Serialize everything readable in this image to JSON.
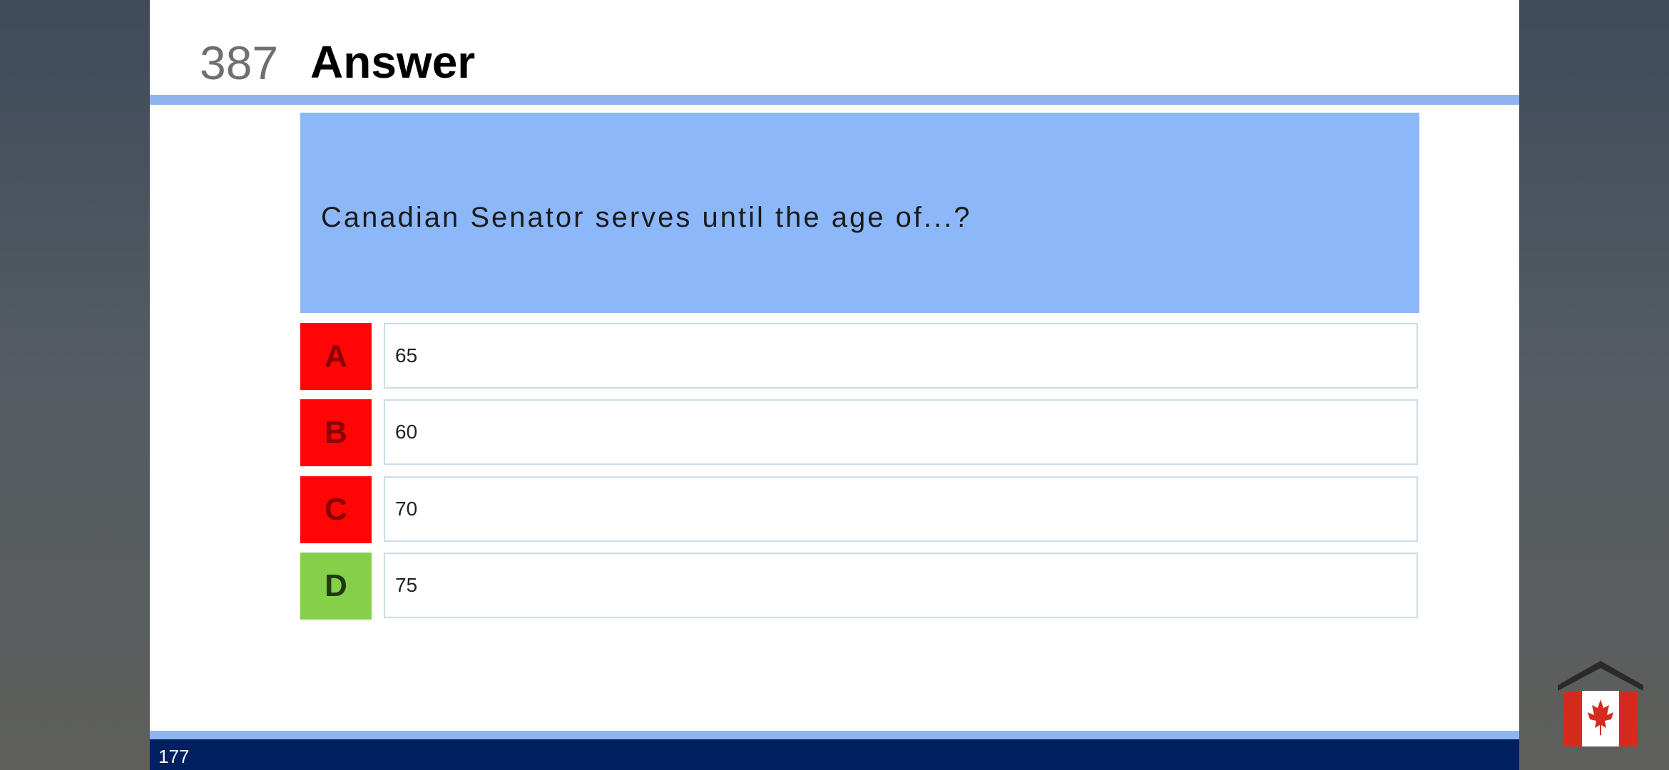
{
  "slide": {
    "number": "387",
    "title": "Answer",
    "question": "Canadian Senator serves until the age of...?",
    "options": [
      {
        "letter": "A",
        "answer": "65",
        "status": "wrong"
      },
      {
        "letter": "B",
        "answer": "60",
        "status": "wrong"
      },
      {
        "letter": "C",
        "answer": "70",
        "status": "wrong"
      },
      {
        "letter": "D",
        "answer": "75",
        "status": "correct"
      }
    ],
    "page_number": "177"
  },
  "colors": {
    "accent": "#8fb5ee",
    "question_bg": "#8cb8fa",
    "wrong": "#ff0505",
    "correct": "#86cf48",
    "footer": "#002060"
  },
  "logo": {
    "icon": "house-canada-flag-icon"
  }
}
